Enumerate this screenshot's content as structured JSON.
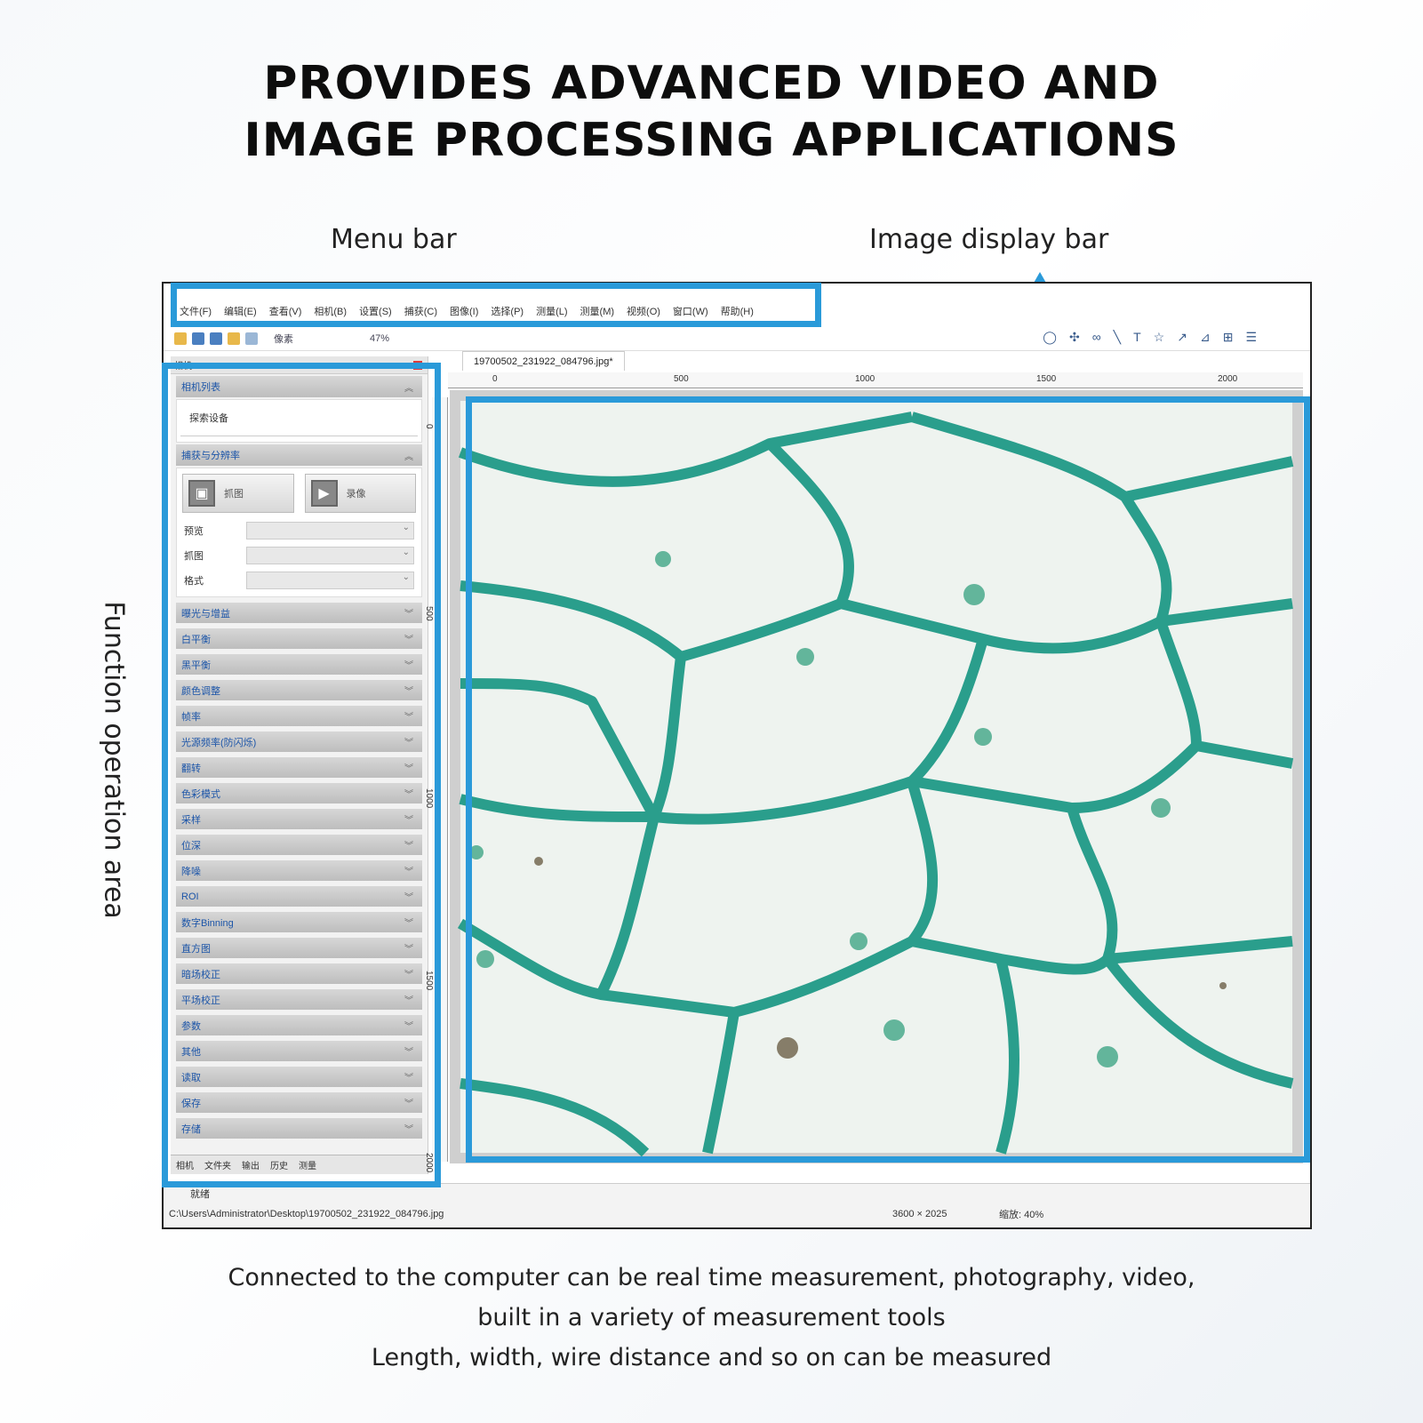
{
  "headline": {
    "line1": "PROVIDES ADVANCED VIDEO AND",
    "line2": "IMAGE PROCESSING APPLICATIONS"
  },
  "callouts": {
    "menu_bar": "Menu bar",
    "image_display_bar": "Image display bar",
    "function_area": "Function operation area"
  },
  "caption": {
    "line1": "Connected to the computer can be real time measurement, photography, video,",
    "line2": "built in a variety of measurement tools",
    "line3": "Length, width, wire distance and so on can be measured"
  },
  "accent_color": "#2a9ad9",
  "app": {
    "menus": [
      "文件(F)",
      "编辑(E)",
      "查看(V)",
      "相机(B)",
      "设置(S)",
      "捕获(C)",
      "图像(I)",
      "选择(P)",
      "测量(L)",
      "测量(M)",
      "视频(O)",
      "窗口(W)",
      "帮助(H)"
    ],
    "toolbar": {
      "units": "像素",
      "zoom": "47%"
    },
    "panel_title": "相机",
    "sections": {
      "camera_list": "相机列表",
      "device": "探索设备",
      "capture_resolution": "捕获与分辨率",
      "snap": "抓图",
      "record": "录像",
      "field1": "预览",
      "field2": "抓图",
      "field3": "格式"
    },
    "collapsed_sections": [
      "曝光与增益",
      "白平衡",
      "黑平衡",
      "颜色调整",
      "帧率",
      "光源频率(防闪烁)",
      "翻转",
      "色彩模式",
      "采样",
      "位深",
      "降噪",
      "ROI",
      "数字Binning",
      "直方图",
      "暗场校正",
      "平场校正",
      "参数",
      "其他",
      "读取",
      "保存",
      "存储"
    ],
    "panel_tabs": [
      "相机",
      "文件夹",
      "输出",
      "历史",
      "测量"
    ],
    "doc_tab": "19700502_231922_084796.jpg*",
    "ruler_top": [
      "0",
      "500",
      "1000",
      "1500",
      "2000"
    ],
    "ruler_left": [
      "0",
      "500",
      "1000",
      "1500",
      "2000"
    ],
    "status": {
      "ready": "就绪",
      "path": "C:\\Users\\Administrator\\Desktop\\19700502_231922_084796.jpg",
      "dims": "3600 × 2025",
      "zoom": "缩放: 40%"
    }
  }
}
